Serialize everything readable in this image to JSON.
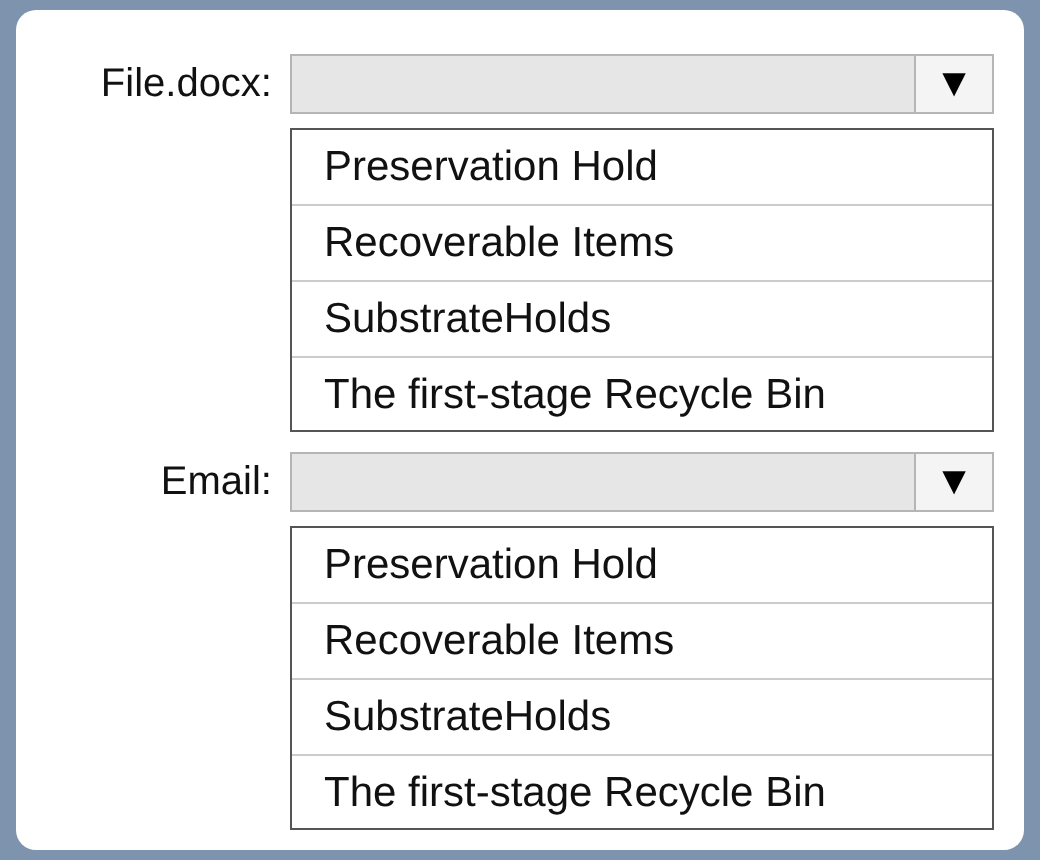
{
  "dropdowns": [
    {
      "label": "File.docx:",
      "arrow": "▼",
      "options": [
        "Preservation Hold",
        "Recoverable Items",
        "SubstrateHolds",
        "The first-stage Recycle Bin"
      ]
    },
    {
      "label": "Email:",
      "arrow": "▼",
      "options": [
        "Preservation Hold",
        "Recoverable Items",
        "SubstrateHolds",
        "The first-stage Recycle Bin"
      ]
    }
  ]
}
